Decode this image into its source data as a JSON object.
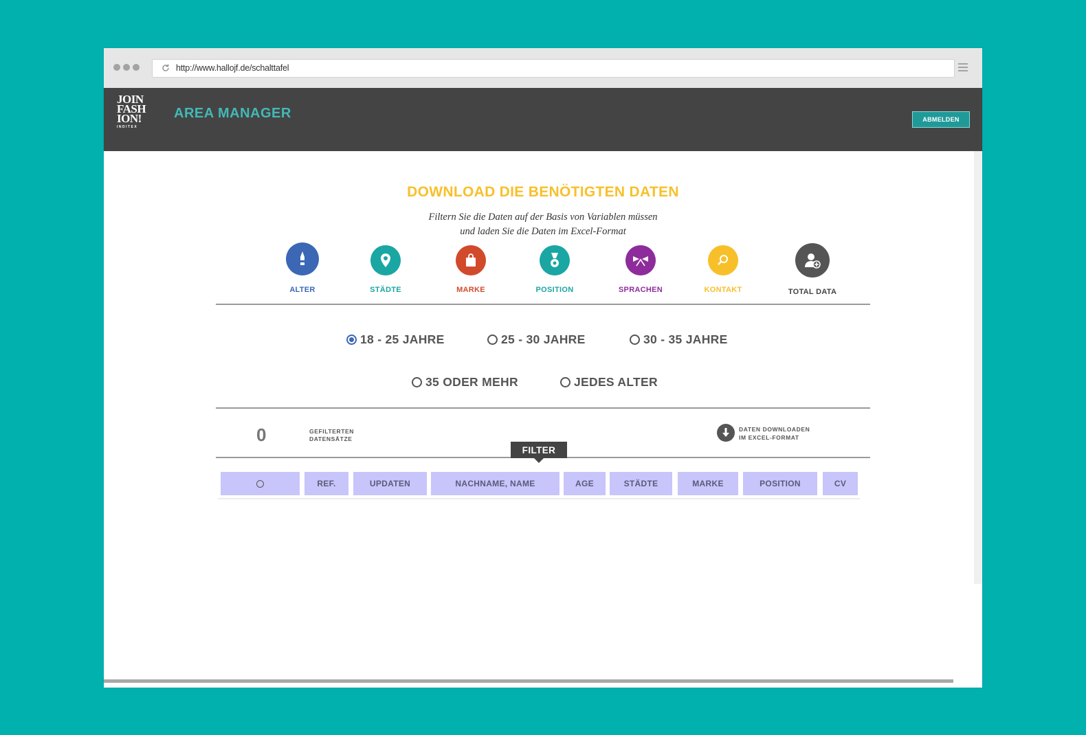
{
  "browser": {
    "url": "http://www.hallojf.de/schalttafel"
  },
  "header": {
    "logo_lines": [
      "JOIN",
      "FASH",
      "ION!"
    ],
    "logo_sub": "INDITEX",
    "title": "AREA MANAGER",
    "logout_label": "ABMELDEN"
  },
  "main": {
    "title": "DOWNLOAD DIE BENÖTIGTEN DATEN",
    "subtitle_line1": "Filtern Sie die Daten auf der Basis von Variablen müssen",
    "subtitle_line2": "und laden Sie die Daten im Excel-Format"
  },
  "categories": [
    {
      "label": "ALTER",
      "icon": "bottle-icon",
      "color": "#3b67b5"
    },
    {
      "label": "STÄDTE",
      "icon": "location-pin-icon",
      "color": "#1aa6a3"
    },
    {
      "label": "MARKE",
      "icon": "shopping-bag-icon",
      "color": "#d24a2c"
    },
    {
      "label": "POSITION",
      "icon": "medal-icon",
      "color": "#1aa6a3"
    },
    {
      "label": "SPRACHEN",
      "icon": "flags-icon",
      "color": "#8e2c9c"
    },
    {
      "label": "KONTAKT",
      "icon": "magnifier-icon",
      "color": "#f7c02b"
    },
    {
      "label": "TOTAL DATA",
      "icon": "user-add-icon",
      "color": "#555555"
    }
  ],
  "age_options": [
    {
      "label": "18 - 25 JAHRE",
      "selected": true
    },
    {
      "label": "25 - 30 JAHRE",
      "selected": false
    },
    {
      "label": "30 - 35 JAHRE",
      "selected": false
    },
    {
      "label": "35 ODER MEHR",
      "selected": false
    },
    {
      "label": "JEDES ALTER",
      "selected": false
    }
  ],
  "summary": {
    "count": "0",
    "count_label_line1": "GEFILTERTEN",
    "count_label_line2": "DATENSÄTZE",
    "download_line1": "DATEN DOWNLOADEN",
    "download_line2": "IM EXCEL-FORMAT",
    "filter_label": "FILTER"
  },
  "table": {
    "columns": [
      "",
      "REF.",
      "UPDATEN",
      "NACHNAME, NAME",
      "AGE",
      "STÄDTE",
      "MARKE",
      "POSITION",
      "CV"
    ]
  },
  "colors": {
    "background": "#00b1ae",
    "header": "#444444",
    "accent_teal": "#43b9b6",
    "title_yellow": "#f7c02b",
    "table_header": "#c8c5fb"
  }
}
